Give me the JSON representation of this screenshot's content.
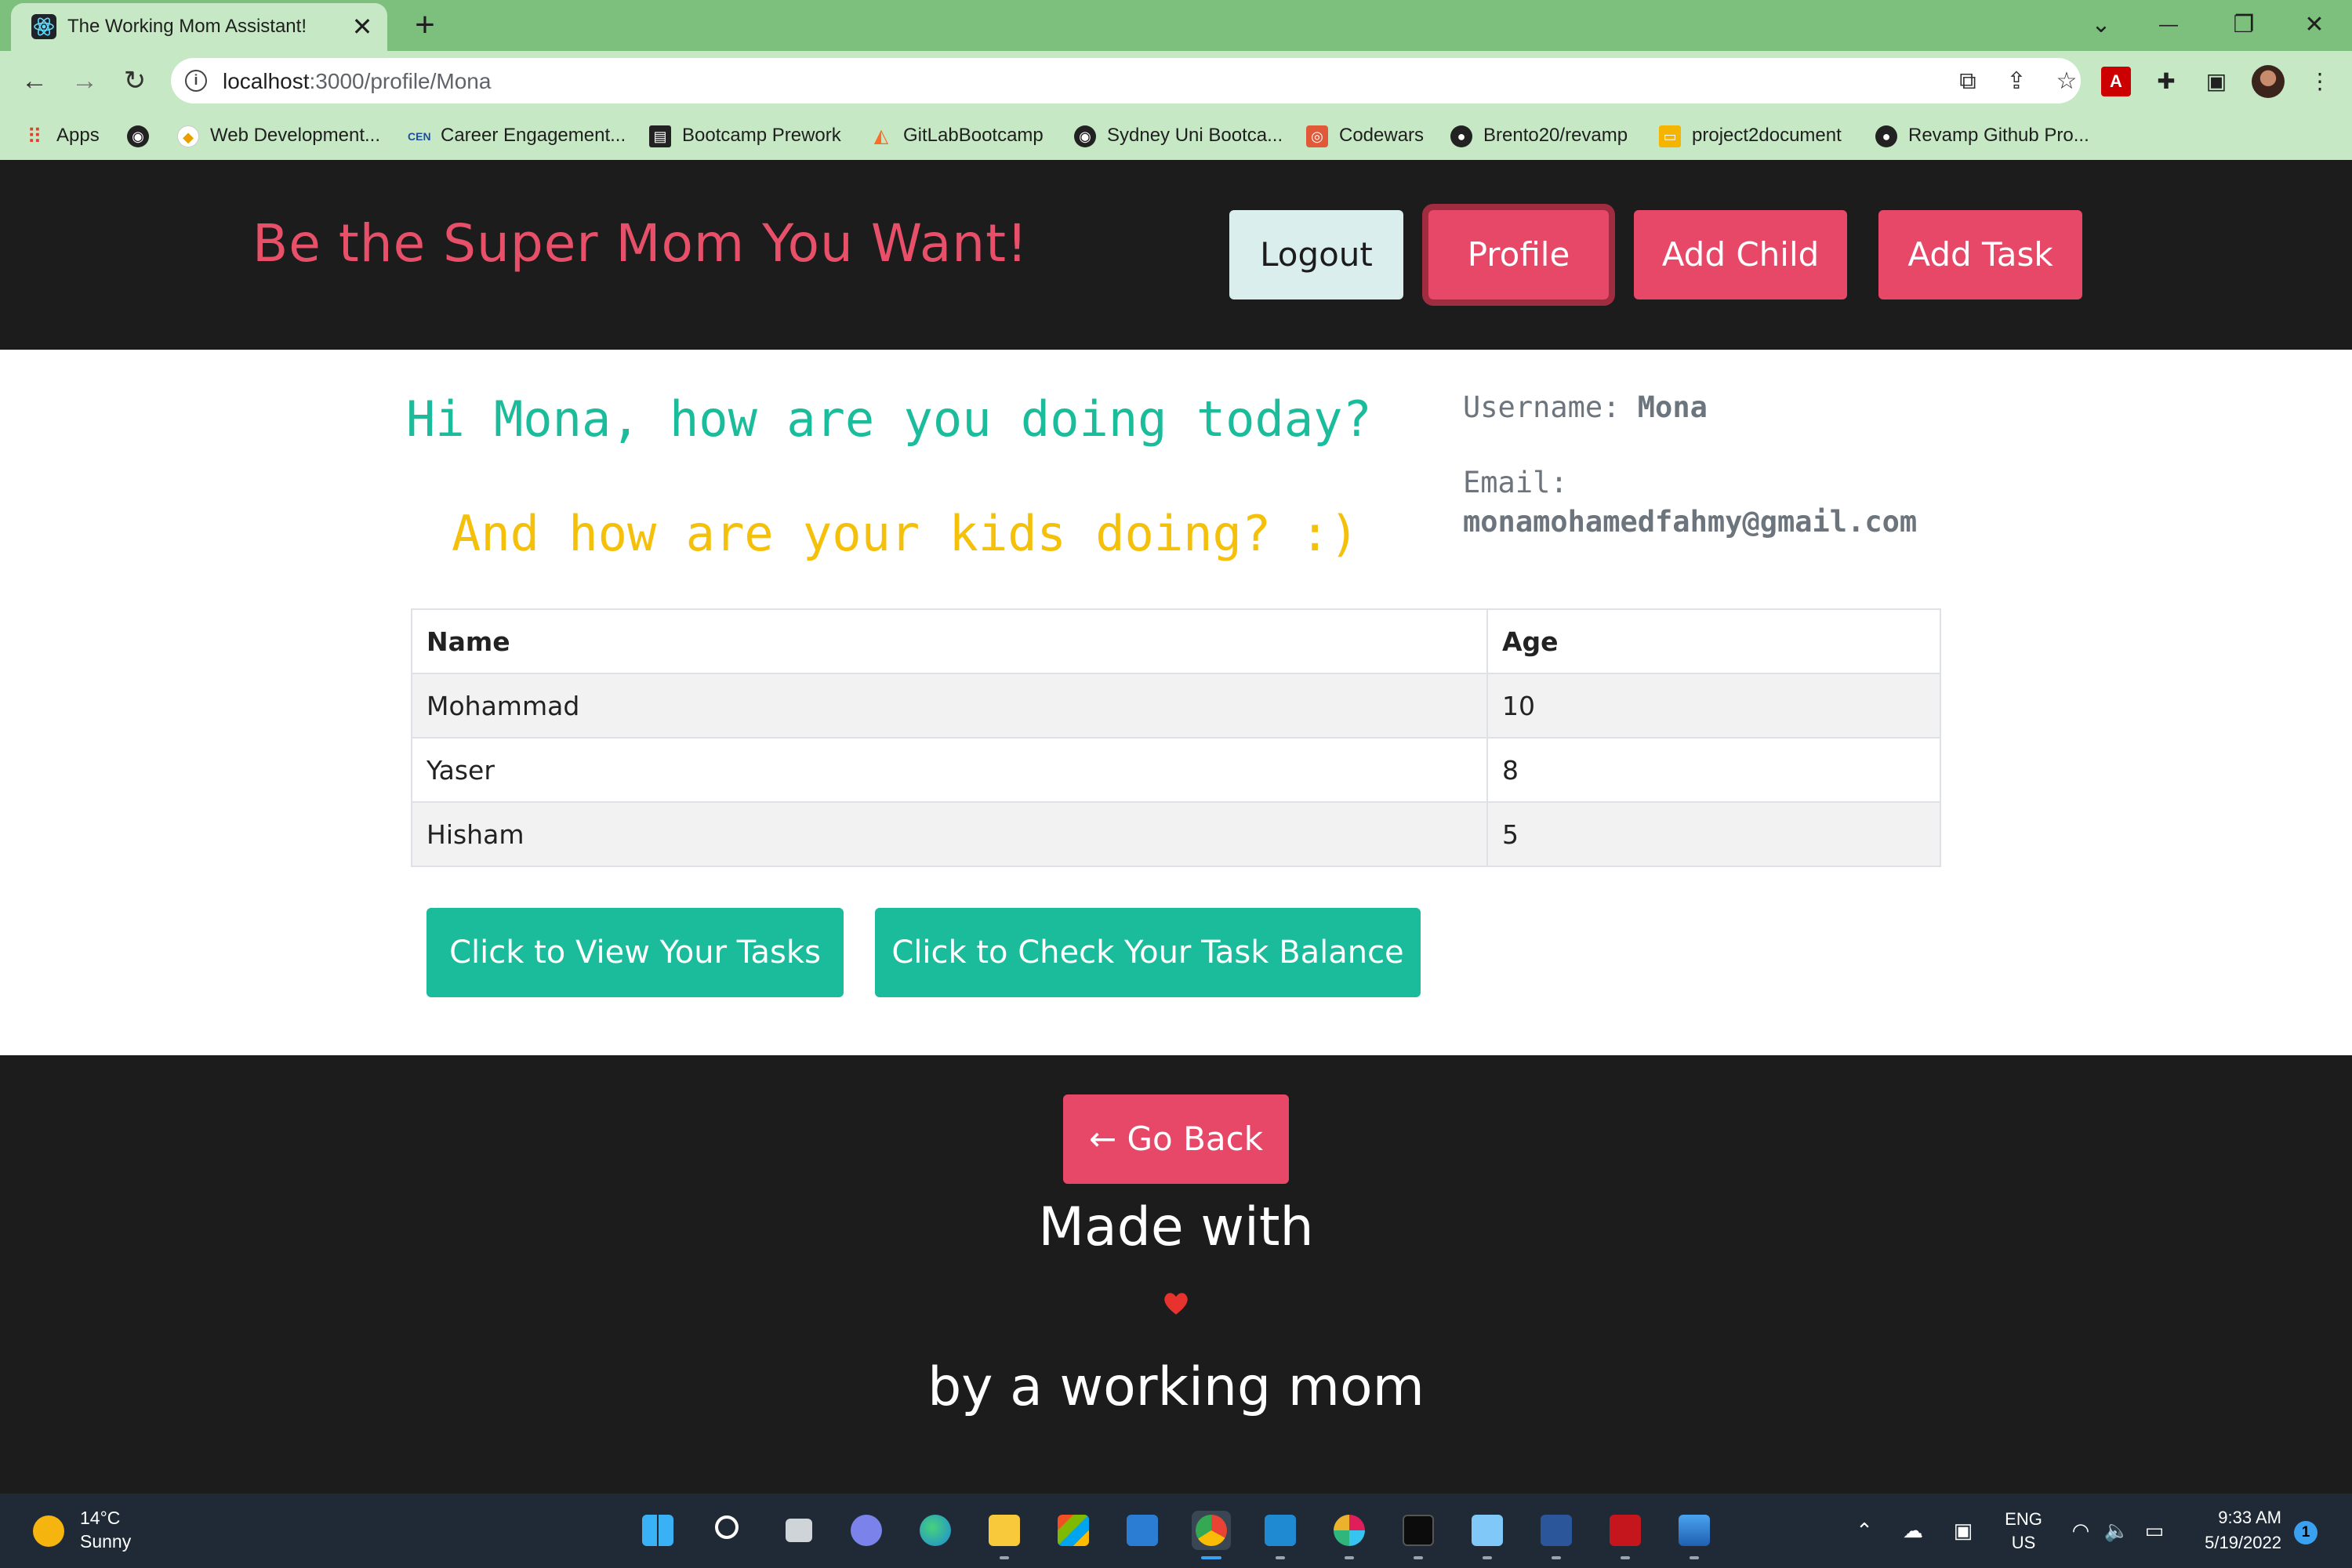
{
  "browser": {
    "tab_title": "The Working Mom Assistant!",
    "tab_close": "✕",
    "new_tab": "+",
    "url_host": "localhost",
    "url_path": ":3000/profile/Mona",
    "window_controls": {
      "dropdown": "⌄",
      "minimize": "—",
      "restore": "❐",
      "close": "✕"
    }
  },
  "bookmarks": [
    {
      "label": "Apps",
      "icon": "apps-grid-icon"
    },
    {
      "label": "Web Development...",
      "icon": "web-icon"
    },
    {
      "label": "Career Engagement...",
      "icon": "cen-icon"
    },
    {
      "label": "Bootcamp Prework",
      "icon": "book-icon"
    },
    {
      "label": "GitLabBootcamp",
      "icon": "gitlab-icon"
    },
    {
      "label": "Sydney Uni Bootca...",
      "icon": "globe-icon"
    },
    {
      "label": "Codewars",
      "icon": "codewars-icon"
    },
    {
      "label": "Brento20/revamp",
      "icon": "github-icon"
    },
    {
      "label": "project2document",
      "icon": "slides-icon"
    },
    {
      "label": "Revamp Github Pro...",
      "icon": "github-icon"
    }
  ],
  "header": {
    "brand": "Be the Super Mom You Want!",
    "buttons": {
      "logout": "Logout",
      "profile": "Profile",
      "add_child": "Add Child",
      "add_task": "Add Task"
    }
  },
  "profile": {
    "greeting": "Hi Mona, how are you doing today?",
    "kids_question": "And how are your kids doing? :)",
    "username_label": "Username:",
    "username": "Mona",
    "email_label": "Email:",
    "email": "monamohamedfahmy@gmail.com"
  },
  "kids_table": {
    "headers": [
      "Name",
      "Age"
    ],
    "rows": [
      [
        "Mohammad",
        "10"
      ],
      [
        "Yaser",
        "8"
      ],
      [
        "Hisham",
        "5"
      ]
    ]
  },
  "actions": {
    "view_tasks": "Click to View Your Tasks",
    "task_balance": "Click to Check Your Task Balance"
  },
  "footer": {
    "go_back": "← Go Back",
    "made_with": "Made with",
    "by": "by a working mom"
  },
  "taskbar": {
    "weather_temp": "14°C",
    "weather_desc": "Sunny",
    "lang_top": "ENG",
    "lang_bottom": "US",
    "time": "9:33 AM",
    "date": "5/19/2022",
    "notifications": "1"
  },
  "colors": {
    "brand": "#e8506a",
    "primary_button": "#e84868",
    "teal": "#1bbc9b",
    "yellow": "#f5c00a",
    "dark": "#1c1c1c",
    "chrome_green": "#7dbf7d"
  }
}
